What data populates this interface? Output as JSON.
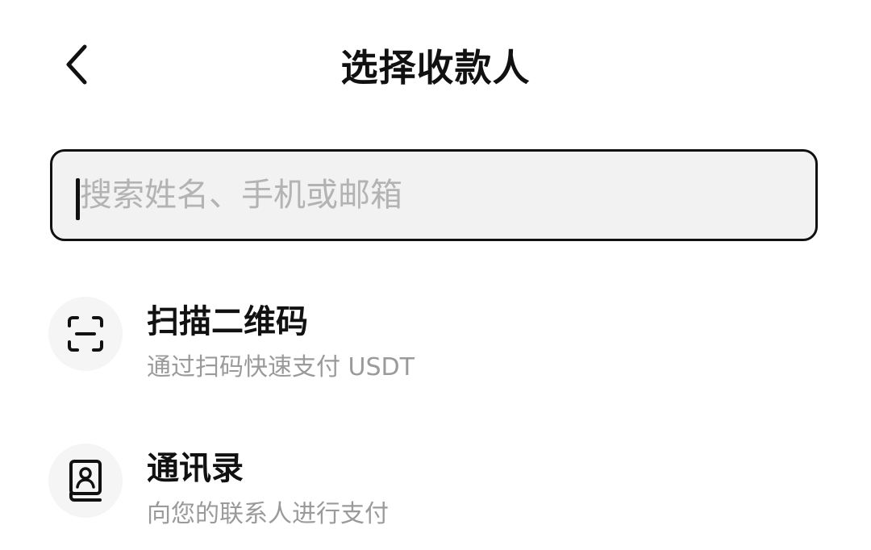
{
  "header": {
    "back_icon": "chevron-left-icon",
    "title": "选择收款人"
  },
  "search": {
    "placeholder": "搜索姓名、手机或邮箱",
    "value": ""
  },
  "options": [
    {
      "icon": "scan-icon",
      "title": "扫描二维码",
      "subtitle": "通过扫码快速支付 USDT"
    },
    {
      "icon": "contacts-book-icon",
      "title": "通讯录",
      "subtitle": "向您的联系人进行支付"
    }
  ],
  "colors": {
    "text_primary": "#111111",
    "text_secondary": "#9a9a9a",
    "placeholder": "#b3b3b3",
    "search_background": "#f2f2f2",
    "icon_background": "#f5f5f5"
  }
}
